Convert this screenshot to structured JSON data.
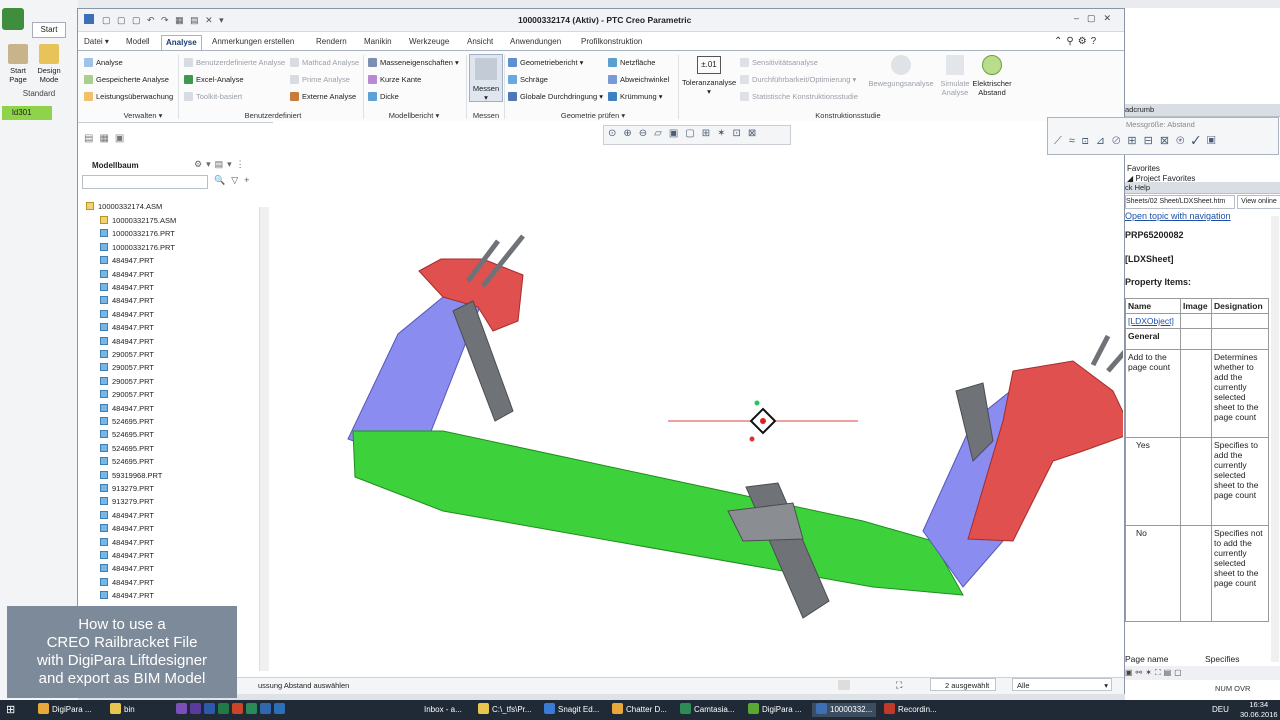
{
  "background_app": {
    "tab_start": "Start",
    "btn_start_page": "Start Page",
    "btn_design_mode": "Design Mode",
    "group_standard": "Standard",
    "item_id": "ld301"
  },
  "window": {
    "title": "10000332174 (Aktiv) - PTC Creo Parametric"
  },
  "ribbon_tabs": [
    "Datei",
    "Modell",
    "Analyse",
    "Anmerkungen erstellen",
    "Rendern",
    "Manikin",
    "Werkzeuge",
    "Ansicht",
    "Anwendungen",
    "Profilkonstruktion"
  ],
  "ribbon": {
    "verwalten": {
      "items": [
        "Analyse",
        "Gespeicherte Analyse",
        "Leistungsüberwachung"
      ],
      "group": "Verwalten"
    },
    "benutzer": {
      "items": [
        "Benutzerdefinierte Analyse",
        "Excel-Analyse",
        "Toolkit-basiert",
        "Mathcad Analyse",
        "Prime Analyse",
        "Externe Analyse"
      ],
      "group": "Benutzerdefiniert"
    },
    "modellbericht": {
      "items": [
        "Masseneigenschaften",
        "Kurze Kante",
        "Dicke"
      ],
      "group": "Modellbericht"
    },
    "messen": {
      "button": "Messen",
      "group": "Messen"
    },
    "geometrie": {
      "items": [
        "Geometriebericht",
        "Schräge",
        "Globale Durchdringung",
        "Netzfläche",
        "Abweichwinkel",
        "Krümmung"
      ],
      "group": "Geometrie prüfen"
    },
    "konstruktion": {
      "toleranz_symbol": "±.01",
      "toleranz": "Toleranzanalyse",
      "items": [
        "Sensitivitätsanalyse",
        "Durchführbarkeit/Optimierung",
        "Statistische Konstruktionsstudie"
      ],
      "bewegung": "Bewegungsanalyse",
      "simulate": "Simulate Analyse",
      "elektrischer": "Elektrischer Abstand",
      "group": "Konstruktionsstudie"
    }
  },
  "tree": {
    "title": "Modellbaum",
    "root": "10000332174.ASM",
    "items": [
      "10000332175.ASM",
      "10000332176.PRT",
      "10000332176.PRT",
      "484947.PRT",
      "484947.PRT",
      "484947.PRT",
      "484947.PRT",
      "484947.PRT",
      "484947.PRT",
      "484947.PRT",
      "290057.PRT",
      "290057.PRT",
      "290057.PRT",
      "290057.PRT",
      "484947.PRT",
      "524695.PRT",
      "524695.PRT",
      "524695.PRT",
      "524695.PRT",
      "59319968.PRT",
      "913279.PRT",
      "913279.PRT",
      "484947.PRT",
      "484947.PRT",
      "484947.PRT",
      "484947.PRT",
      "484947.PRT",
      "484947.PRT",
      "484947.PRT"
    ]
  },
  "status": {
    "message": "ussung Abstand auswählen",
    "selected": "2 ausgewählt",
    "filter": "Alle"
  },
  "right_pane": {
    "breadcrumb": "adcrumb",
    "measure_title": "Messgröße: Abstand",
    "favorites": "Favorites",
    "project_favorites": "Project Favorites",
    "quick_help": "ck Help",
    "path": "Sheets/02 Sheet/LDXSheet.htm",
    "view_online": "View online",
    "open_topic": "Open topic with navigation",
    "code": "PRP65200082",
    "sheet": "[LDXSheet]",
    "property_items": "Property Items:",
    "columns": [
      "Name",
      "Image",
      "Designation"
    ],
    "ldx_object": "[LDXObject]",
    "general": "General",
    "rows": [
      {
        "name": "Add to the page count",
        "desc": "Determines whether to add the currently selected sheet to the page count"
      },
      {
        "name": "Yes",
        "desc": "Specifies to add the currently selected sheet to the page count"
      },
      {
        "name": "No",
        "desc": "Specifies not to add the currently selected sheet to the page count"
      },
      {
        "name": "Page name",
        "desc": "Specifies"
      }
    ],
    "num_ovr": "NUM  OVR"
  },
  "overlay": {
    "lines": [
      "How to use a",
      "CREO Railbracket File",
      "with DigiPara Liftdesigner",
      "and export as BIM Model"
    ]
  },
  "taskbar": {
    "items": [
      "DigiPara ...",
      "bin",
      "Inbox - a...",
      "C:\\_tfs\\Pr...",
      "Snagit Ed...",
      "Chatter D...",
      "Camtasia...",
      "DigiPara ...",
      "10000332...",
      "Recordin..."
    ],
    "lang": "DEU",
    "time": "16:34",
    "date": "30.06.2016"
  },
  "colors": {
    "accent": "#1a3c6e",
    "taskbar": "#1f2a36",
    "overlay": "#7d8a99",
    "bracket_red": "#e0504e",
    "bracket_blue": "#8b8cf0",
    "beam_green": "#3dd23b",
    "steel_grey": "#6f7378"
  }
}
